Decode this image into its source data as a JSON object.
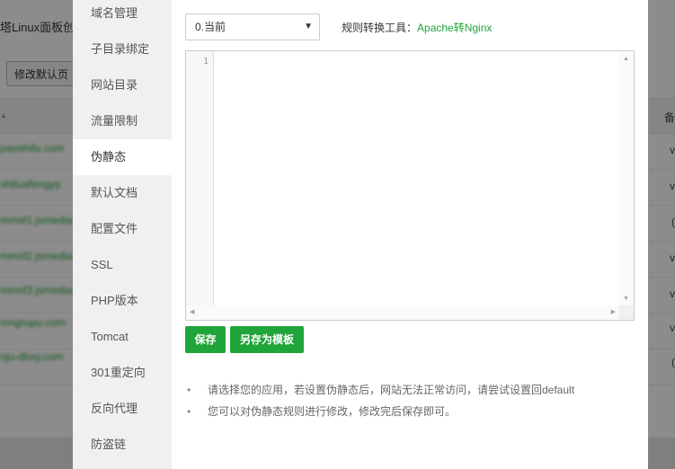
{
  "background": {
    "title": "塔Linux面板创",
    "modify_button": "修改默认页",
    "rows": [
      {
        "link": "paoshifu.com",
        "status": "v"
      },
      {
        "link": "shituafengyy.",
        "status": "v"
      },
      {
        "link": "mmsf1.jsmedia.",
        "status": "("
      },
      {
        "link": "mmsf2.jsmedia.",
        "status": "v"
      },
      {
        "link": "mmsf3.jsmedia.",
        "status": "v"
      },
      {
        "link": "mngrupu.com",
        "status": "v"
      },
      {
        "link": "nju-dbxy.com",
        "status": "("
      }
    ],
    "right_header": "备"
  },
  "sidebar": {
    "items": [
      {
        "label": "域名管理",
        "active": false
      },
      {
        "label": "子目录绑定",
        "active": false
      },
      {
        "label": "网站目录",
        "active": false
      },
      {
        "label": "流量限制",
        "active": false
      },
      {
        "label": "伪静态",
        "active": true
      },
      {
        "label": "默认文档",
        "active": false
      },
      {
        "label": "配置文件",
        "active": false
      },
      {
        "label": "SSL",
        "active": false
      },
      {
        "label": "PHP版本",
        "active": false
      },
      {
        "label": "Tomcat",
        "active": false
      },
      {
        "label": "301重定向",
        "active": false
      },
      {
        "label": "反向代理",
        "active": false
      },
      {
        "label": "防盗链",
        "active": false
      }
    ]
  },
  "rewrite": {
    "select_value": "0.当前",
    "tool_label": "规则转换工具：",
    "tool_link": "Apache转Nginx",
    "editor": {
      "line_number": "1",
      "content": ""
    },
    "save_label": "保存",
    "save_template_label": "另存为模板",
    "tips": [
      "请选择您的应用，若设置伪静态后，网站无法正常访问，请尝试设置回default",
      "您可以对伪静态规则进行修改，修改完后保存即可。"
    ]
  },
  "colors": {
    "accent": "#20a53a",
    "sidebar_bg": "#f0f0f0"
  }
}
